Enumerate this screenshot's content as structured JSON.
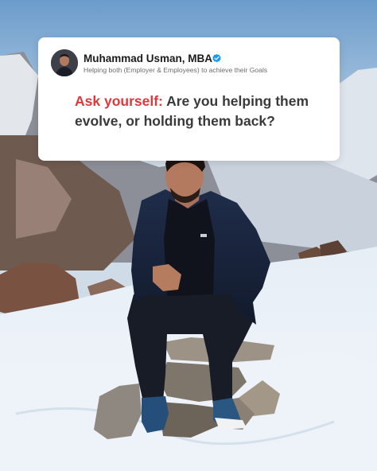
{
  "post": {
    "author_name": "Muhammad Usman, MBA",
    "author_tagline": "Helping both (Employer & Employees) to achieve their Goals",
    "verified_icon": "verified-badge-icon",
    "headline_highlight": "Ask yourself:",
    "headline_rest": "Are you helping them evolve, or holding them back?"
  },
  "colors": {
    "accent": "#e0383c",
    "verified": "#1d9bf0",
    "headline": "#3a3a3a",
    "card": "#ffffff"
  }
}
